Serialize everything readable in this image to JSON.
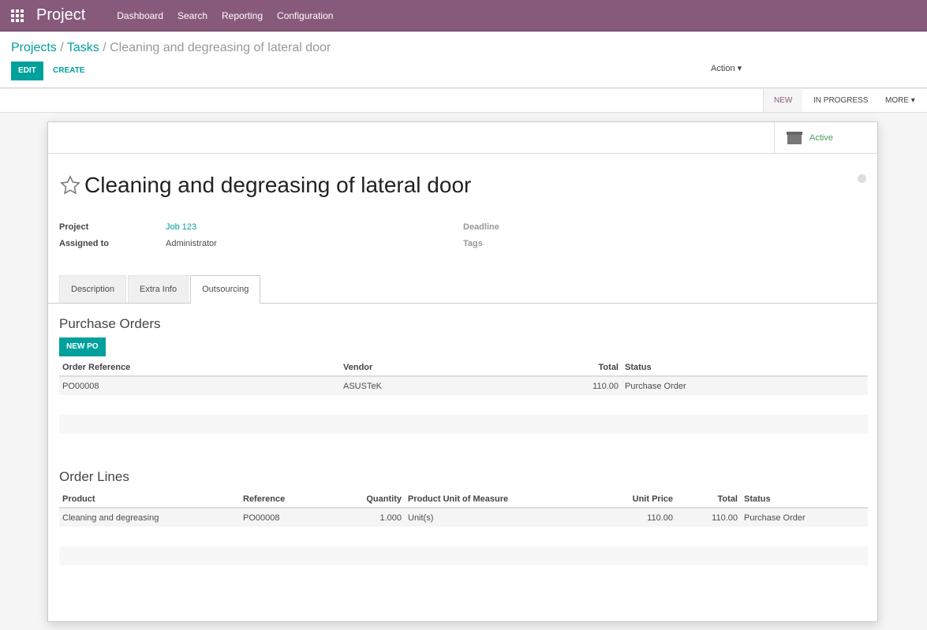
{
  "nav": {
    "brand": "Project",
    "menu": [
      "Dashboard",
      "Search",
      "Reporting",
      "Configuration"
    ]
  },
  "breadcrumb": {
    "projects": "Projects",
    "tasks": "Tasks",
    "current": "Cleaning and degreasing of lateral door",
    "sep": "/"
  },
  "toolbar": {
    "edit": "EDIT",
    "create": "CREATE",
    "action": "Action ▾"
  },
  "status": {
    "stages": [
      "NEW",
      "IN PROGRESS",
      "MORE ▾"
    ],
    "current": "NEW"
  },
  "sheet": {
    "active_label": "Active",
    "title": "Cleaning and degreasing of lateral door",
    "fields": {
      "project_label": "Project",
      "project": "Job 123",
      "assigned_label": "Assigned to",
      "assigned": "Administrator",
      "deadline_label": "Deadline",
      "tags_label": "Tags"
    },
    "tabs": [
      "Description",
      "Extra Info",
      "Outsourcing"
    ],
    "active_tab": "Outsourcing"
  },
  "po": {
    "title": "Purchase Orders",
    "new_btn": "NEW PO",
    "headers": [
      "Order Reference",
      "Vendor",
      "Total",
      "Status"
    ],
    "rows": [
      [
        "PO00008",
        "ASUSTeK",
        "110.00",
        "Purchase Order"
      ]
    ]
  },
  "lines": {
    "title": "Order Lines",
    "headers": [
      "Product",
      "Reference",
      "Quantity",
      "Product Unit of Measure",
      "Unit Price",
      "Total",
      "Status"
    ],
    "rows": [
      [
        "Cleaning and degreasing",
        "PO00008",
        "1.000",
        "Unit(s)",
        "110.00",
        "110.00",
        "Purchase Order"
      ]
    ]
  },
  "colors": {
    "brand": "#875a7b",
    "accent": "#00a09d",
    "active": "#4a9b5e"
  }
}
